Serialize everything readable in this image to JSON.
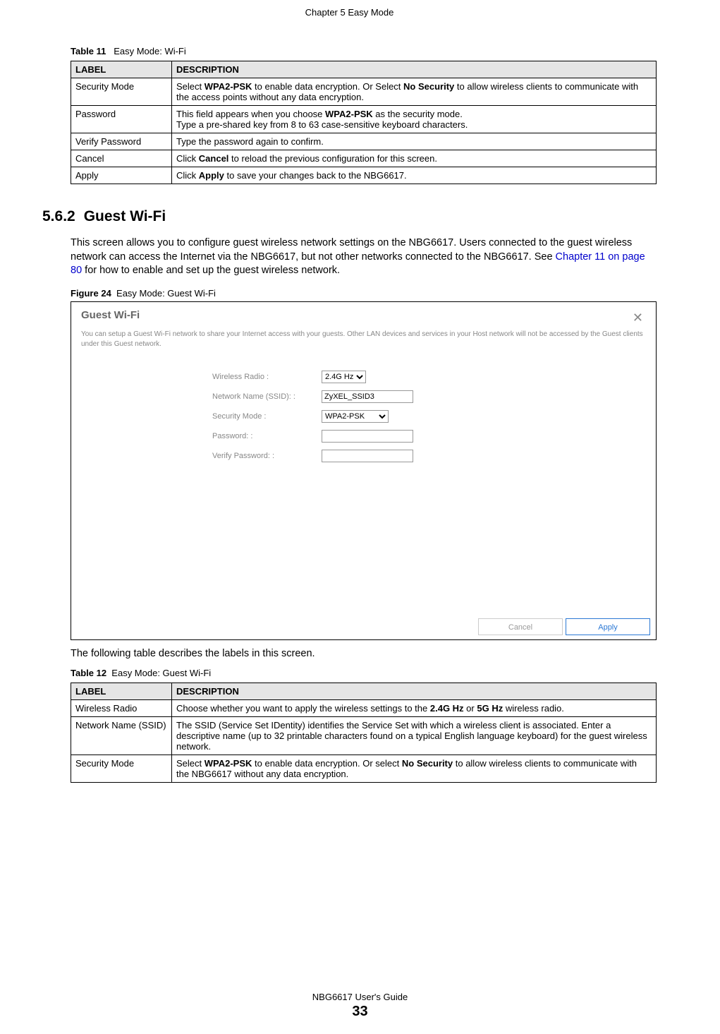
{
  "running_header": "Chapter 5 Easy Mode",
  "table11": {
    "caption_prefix": "Table 11",
    "caption_text": "Easy Mode: Wi-Fi",
    "head_label": "LABEL",
    "head_desc": "DESCRIPTION",
    "rows": [
      {
        "label": "Security Mode",
        "desc_pre": "Select ",
        "desc_b1": "WPA2-PSK",
        "desc_mid1": " to enable data encryption. Or Select ",
        "desc_b2": "No Security",
        "desc_post": " to allow wireless clients to communicate with the access points without any data encryption."
      },
      {
        "label": "Password",
        "desc_pre": "This field appears when you choose ",
        "desc_b1": "WPA2-PSK",
        "desc_mid1": " as the security mode.",
        "desc_line2": "Type a pre-shared key from 8 to 63 case-sensitive keyboard characters."
      },
      {
        "label": "Verify Password",
        "desc_plain": "Type the password again to confirm."
      },
      {
        "label": "Cancel",
        "desc_pre": "Click ",
        "desc_b1": "Cancel",
        "desc_post": " to reload the previous configuration for this screen."
      },
      {
        "label": "Apply",
        "desc_pre": "Click ",
        "desc_b1": "Apply",
        "desc_post": " to save your changes back to the NBG6617."
      }
    ]
  },
  "section": {
    "number": "5.6.2",
    "title": "Guest Wi-Fi",
    "para_pre": "This screen allows you to configure guest wireless network settings on the NBG6617. Users connected to the guest wireless network can access the Internet via the NBG6617, but not other networks connected to the NBG6617. See ",
    "para_xref": "Chapter 11 on page 80",
    "para_post": " for how to enable and set up the guest wireless network."
  },
  "figure": {
    "caption_prefix": "Figure 24",
    "caption_text": "Easy Mode: Guest Wi-Fi",
    "panel_title": "Guest Wi-Fi",
    "close_glyph": "✕",
    "panel_desc": "You can setup a Guest Wi-Fi network to share your Internet access with your guests. Other LAN devices and services in your Host network will not be accessed by the Guest clients under this Guest network.",
    "fields": {
      "wireless_radio_label": "Wireless Radio :",
      "wireless_radio_value": "2.4G Hz",
      "ssid_label": "Network Name (SSID): :",
      "ssid_value": "ZyXEL_SSID3",
      "sec_mode_label": "Security Mode :",
      "sec_mode_value": "WPA2-PSK",
      "password_label": "Password: :",
      "password_value": "",
      "verify_password_label": "Verify Password: :",
      "verify_password_value": ""
    },
    "buttons": {
      "cancel": "Cancel",
      "apply": "Apply"
    }
  },
  "post_figure_para": "The following table describes the labels in this screen.",
  "table12": {
    "caption_prefix": "Table 12",
    "caption_text": "Easy Mode: Guest Wi-Fi",
    "head_label": "LABEL",
    "head_desc": "DESCRIPTION",
    "rows": [
      {
        "label": "Wireless Radio",
        "desc_pre": "Choose whether you want to apply the wireless settings to the ",
        "desc_b1": "2.4G Hz",
        "desc_mid1": " or ",
        "desc_b2": "5G Hz",
        "desc_post": " wireless radio."
      },
      {
        "label": "Network Name (SSID)",
        "desc_plain": "The SSID (Service Set IDentity) identifies the Service Set with which a wireless client is associated. Enter a descriptive name (up to 32 printable characters found on a typical English language keyboard) for the guest wireless network."
      },
      {
        "label": "Security Mode",
        "desc_pre": "Select ",
        "desc_b1": "WPA2-PSK",
        "desc_mid1": " to enable data encryption. Or select ",
        "desc_b2": "No Security",
        "desc_post": " to allow wireless clients to communicate with the NBG6617 without any data encryption."
      }
    ]
  },
  "footer": {
    "guide": "NBG6617 User's Guide",
    "page": "33"
  }
}
